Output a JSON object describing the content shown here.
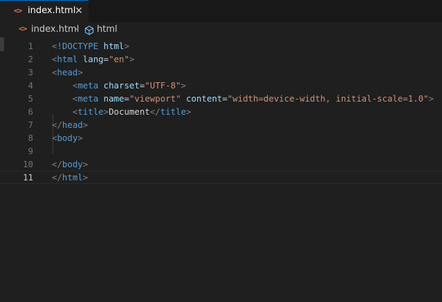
{
  "tab": {
    "icon": "html-code-icon",
    "label": "index.html",
    "close_glyph": "✕",
    "accent": "#0078d4"
  },
  "breadcrumb": {
    "file": "index.html",
    "separator": "›",
    "symbol": "html"
  },
  "editor": {
    "current_line": 11,
    "colors": {
      "tag": "#569cd6",
      "attribute": "#9cdcfe",
      "string": "#ce9178",
      "bracket": "#808080",
      "text": "#d4d4d4"
    },
    "lines": [
      {
        "n": "1",
        "tokens": [
          [
            "bracket",
            "<"
          ],
          [
            "tag",
            "!DOCTYPE"
          ],
          [
            "text",
            " "
          ],
          [
            "attr",
            "html"
          ],
          [
            "bracket",
            ">"
          ]
        ]
      },
      {
        "n": "2",
        "tokens": [
          [
            "bracket",
            "<"
          ],
          [
            "tag",
            "html"
          ],
          [
            "text",
            " "
          ],
          [
            "attr",
            "lang"
          ],
          [
            "text",
            "="
          ],
          [
            "string",
            "\"en\""
          ],
          [
            "bracket",
            ">"
          ]
        ]
      },
      {
        "n": "3",
        "tokens": [
          [
            "bracket",
            "<"
          ],
          [
            "tag",
            "head"
          ],
          [
            "bracket",
            ">"
          ]
        ]
      },
      {
        "n": "4",
        "tokens": [
          [
            "text",
            "    "
          ],
          [
            "bracket",
            "<"
          ],
          [
            "tag",
            "meta"
          ],
          [
            "text",
            " "
          ],
          [
            "attr",
            "charset"
          ],
          [
            "text",
            "="
          ],
          [
            "string",
            "\"UTF-8\""
          ],
          [
            "bracket",
            ">"
          ]
        ]
      },
      {
        "n": "5",
        "tokens": [
          [
            "text",
            "    "
          ],
          [
            "bracket",
            "<"
          ],
          [
            "tag",
            "meta"
          ],
          [
            "text",
            " "
          ],
          [
            "attr",
            "name"
          ],
          [
            "text",
            "="
          ],
          [
            "string",
            "\"viewport\""
          ],
          [
            "text",
            " "
          ],
          [
            "attr",
            "content"
          ],
          [
            "text",
            "="
          ],
          [
            "string",
            "\"width=device-width, initial-scale=1.0\""
          ],
          [
            "bracket",
            ">"
          ]
        ]
      },
      {
        "n": "6",
        "tokens": [
          [
            "text",
            "    "
          ],
          [
            "bracket",
            "<"
          ],
          [
            "tag",
            "title"
          ],
          [
            "bracket",
            ">"
          ],
          [
            "text",
            "Document"
          ],
          [
            "bracket",
            "</"
          ],
          [
            "tag",
            "title"
          ],
          [
            "bracket",
            ">"
          ]
        ]
      },
      {
        "n": "7",
        "tokens": [
          [
            "bracket",
            "</"
          ],
          [
            "tag",
            "head"
          ],
          [
            "bracket",
            ">"
          ]
        ]
      },
      {
        "n": "8",
        "tokens": [
          [
            "bracket",
            "<"
          ],
          [
            "tag",
            "body"
          ],
          [
            "bracket",
            ">"
          ]
        ]
      },
      {
        "n": "9",
        "tokens": []
      },
      {
        "n": "10",
        "tokens": [
          [
            "bracket",
            "</"
          ],
          [
            "tag",
            "body"
          ],
          [
            "bracket",
            ">"
          ]
        ]
      },
      {
        "n": "11",
        "tokens": [
          [
            "bracket",
            "</"
          ],
          [
            "tag",
            "html"
          ],
          [
            "bracket",
            ">"
          ]
        ]
      }
    ]
  }
}
